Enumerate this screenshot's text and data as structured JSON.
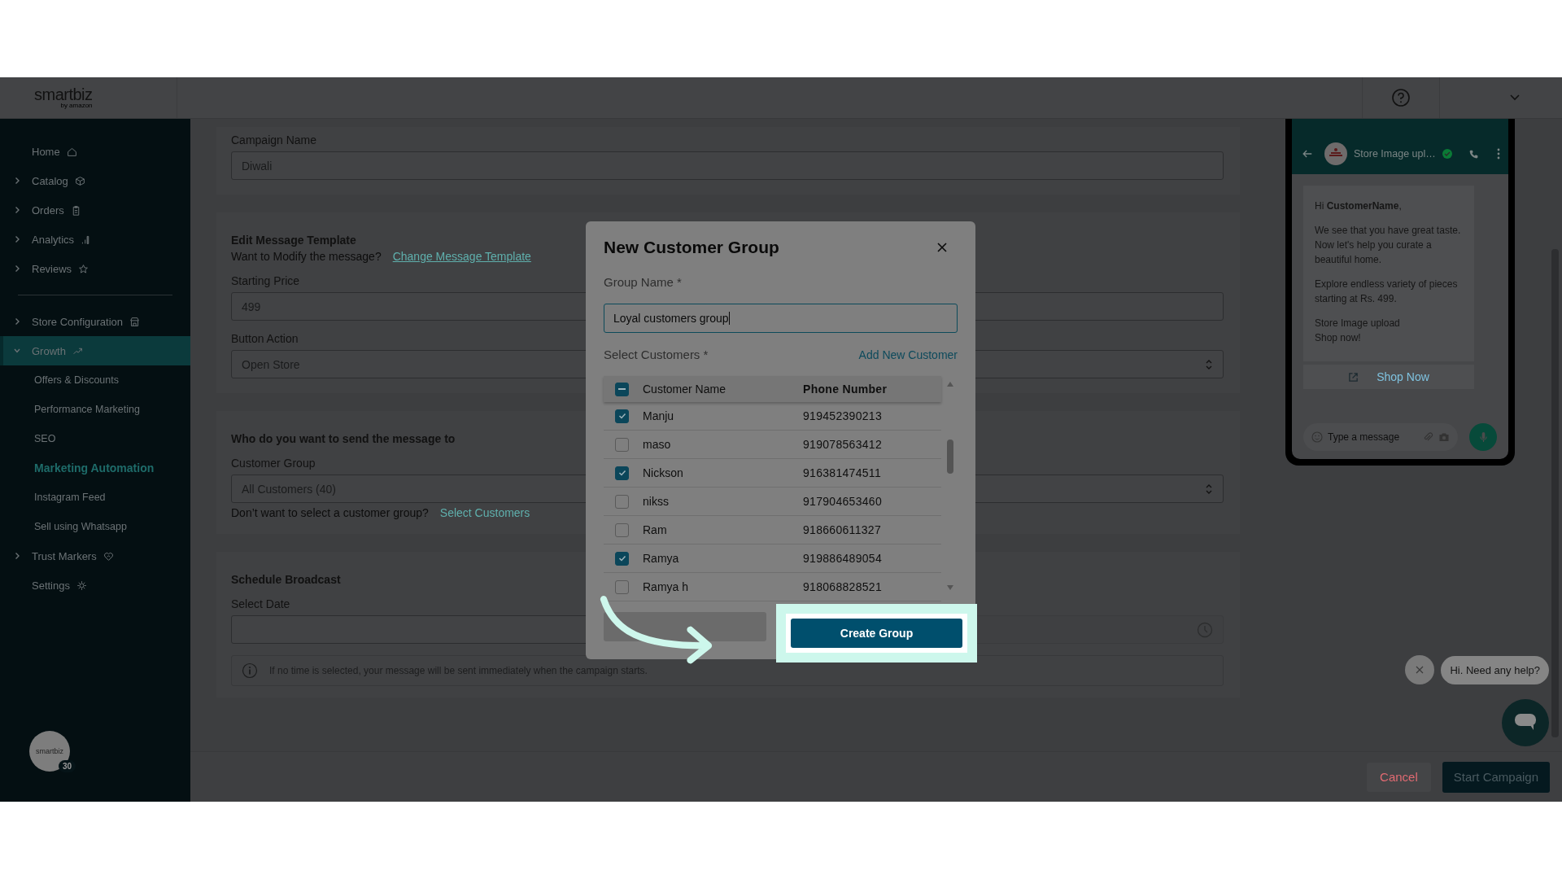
{
  "header": {
    "logo": "smartbiz",
    "logo_sub": "by amazon"
  },
  "sidebar": {
    "groups": [
      [
        {
          "label": "Home",
          "expandable": false,
          "selected": false
        },
        {
          "label": "Catalog",
          "expandable": true,
          "expanded": false,
          "selected": false
        },
        {
          "label": "Orders",
          "expandable": true,
          "expanded": false,
          "selected": false
        },
        {
          "label": "Analytics",
          "expandable": true,
          "expanded": false,
          "selected": false
        },
        {
          "label": "Reviews",
          "expandable": true,
          "expanded": false,
          "selected": false
        }
      ],
      [
        {
          "label": "Store Configuration",
          "expandable": true,
          "expanded": false,
          "selected": false
        },
        {
          "label": "Growth",
          "expandable": true,
          "expanded": true,
          "selected": true,
          "children": [
            {
              "label": "Offers & Discounts",
              "selected": false
            },
            {
              "label": "Performance Marketing",
              "selected": false
            },
            {
              "label": "SEO",
              "selected": false
            },
            {
              "label": "Marketing Automation",
              "selected": true
            },
            {
              "label": "Instagram Feed",
              "selected": false
            },
            {
              "label": "Sell using Whatsapp",
              "selected": false
            }
          ]
        },
        {
          "label": "Trust Markers",
          "expandable": true,
          "expanded": false,
          "selected": false
        },
        {
          "label": "Settings",
          "expandable": false,
          "selected": false
        }
      ]
    ],
    "avatar": {
      "logo": "smartbiz",
      "badge": "30"
    }
  },
  "form": {
    "campaign_name": {
      "label": "Campaign Name",
      "value": "Diwali"
    },
    "template": {
      "title": "Edit Message Template",
      "prompt": "Want to Modify the message?",
      "link": "Change Message Template"
    },
    "starting_price": {
      "label": "Starting Price",
      "value": "499"
    },
    "button_action": {
      "label": "Button Action",
      "value": "Open Store"
    },
    "audience": {
      "title": "Who do you want to send the message to",
      "group_label": "Customer Group",
      "group_value": "All Customers (40)",
      "alt_prompt": "Don’t want to select a customer group?",
      "alt_link": "Select Customers"
    },
    "schedule": {
      "title": "Schedule Broadcast",
      "date_label": "Select Date",
      "info": "If no time is selected, your message will be sent immediately when the campaign starts."
    }
  },
  "footer": {
    "cancel": "Cancel",
    "start": "Start Campaign"
  },
  "preview": {
    "contact": "Store Image upl…",
    "greeting": "Hi **CustomerName**,",
    "paragraphs": [
      " We see that you have great taste. Now let's help you curate a beautiful home.",
      " Explore endless variety of pieces starting at Rs. 499.",
      " Store Image upload\n Shop now!"
    ],
    "button": "Shop Now",
    "placeholder": "Type a message"
  },
  "chat_widget": {
    "prompt": "Hi. Need any help?"
  },
  "modal": {
    "title": "New Customer Group",
    "group_label": "Group Name *",
    "group_value": "Loyal customers group",
    "customers_label": "Select Customers *",
    "add_link": "Add New Customer",
    "select_all": {
      "indeterminate": true
    },
    "columns": [
      "Customer Name",
      "Phone Number"
    ],
    "rows": [
      {
        "name": "Manju",
        "phone": "919452390213",
        "checked": true
      },
      {
        "name": "maso",
        "phone": "919078563412",
        "checked": false
      },
      {
        "name": "Nickson",
        "phone": "916381474511",
        "checked": true
      },
      {
        "name": "nikss",
        "phone": "917904653460",
        "checked": false
      },
      {
        "name": "Ram",
        "phone": "918660611327",
        "checked": false
      },
      {
        "name": "Ramya",
        "phone": "919886489054",
        "checked": true
      },
      {
        "name": "Ramya h",
        "phone": "918068828521",
        "checked": false
      }
    ],
    "create_button": "Create Group"
  }
}
